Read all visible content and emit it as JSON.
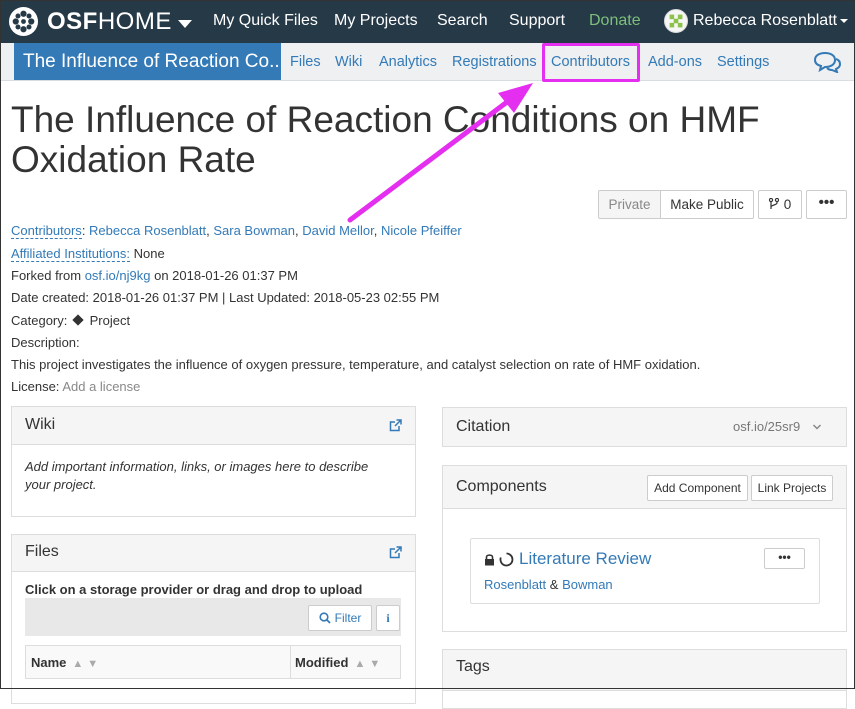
{
  "topnav": {
    "brand_osf": "OSF",
    "brand_home": "HOME",
    "links": [
      "My Quick Files",
      "My Projects",
      "Search",
      "Support",
      "Donate"
    ],
    "user_name": "Rebecca Rosenblatt",
    "colors": {
      "bg": "#263947",
      "donate": "#7dbf7c"
    }
  },
  "subnav": {
    "project_title": "The Influence of Reaction Co...",
    "links": [
      "Files",
      "Wiki",
      "Analytics",
      "Registrations",
      "Contributors",
      "Add-ons",
      "Settings"
    ],
    "colors": {
      "accent": "#337ab7",
      "highlight": "#e42ff0"
    }
  },
  "page": {
    "title": "The Influence of Reaction Conditions on HMF Oxidation Rate"
  },
  "actions": {
    "private": "Private",
    "make_public": "Make Public",
    "fork_count": "0",
    "more": "•••"
  },
  "meta": {
    "contributors_label": "Contributors",
    "contributors": [
      "Rebecca Rosenblatt",
      "Sara Bowman",
      "David Mellor",
      "Nicole Pfeiffer"
    ],
    "affiliated_label": "Affiliated Institutions:",
    "affiliated_value": "None",
    "forked_prefix": "Forked from",
    "forked_link": "osf.io/nj9kg",
    "forked_suffix": "on 2018-01-26 01:37 PM",
    "date_line": "Date created: 2018-01-26 01:37 PM | Last Updated: 2018-05-23 02:55 PM",
    "category_label": "Category:",
    "category_value": "Project",
    "description_label": "Description:",
    "description": "This project investigates the influence of oxygen pressure, temperature, and catalyst selection on rate of HMF oxidation.",
    "license_label": "License:",
    "license_value": "Add a license"
  },
  "wiki": {
    "title": "Wiki",
    "placeholder": "Add important information, links, or images here to describe your project."
  },
  "files": {
    "title": "Files",
    "instruction": "Click on a storage provider or drag and drop to upload",
    "filter": "Filter",
    "info": "i",
    "col_name": "Name",
    "col_modified": "Modified"
  },
  "citation": {
    "title": "Citation",
    "link": "osf.io/25sr9"
  },
  "components": {
    "title": "Components",
    "add": "Add Component",
    "link": "Link Projects",
    "item_title": "Literature Review",
    "item_author1": "Rosenblatt",
    "item_amp": "&",
    "item_author2": "Bowman",
    "item_more": "•••"
  },
  "tags": {
    "title": "Tags"
  }
}
